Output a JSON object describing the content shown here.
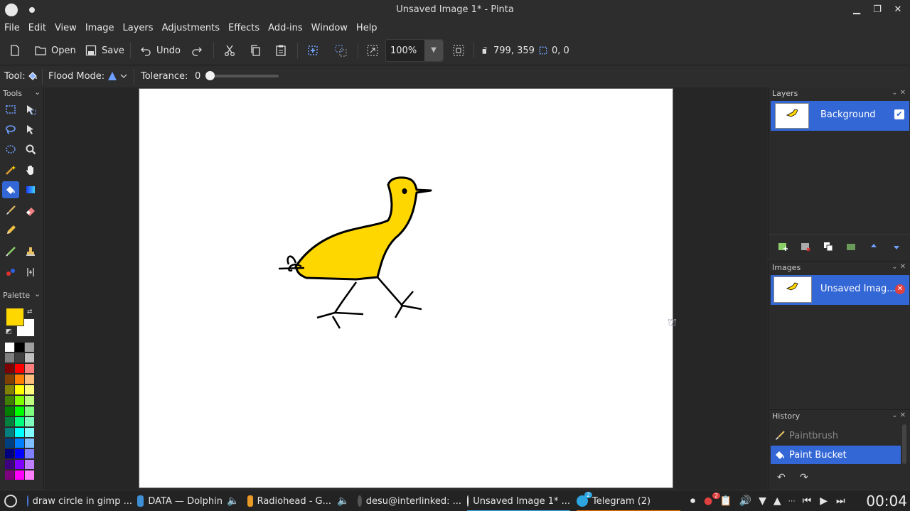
{
  "window": {
    "title": "Unsaved Image 1* - Pinta"
  },
  "menu": [
    "File",
    "Edit",
    "View",
    "Image",
    "Layers",
    "Adjustments",
    "Effects",
    "Add-ins",
    "Window",
    "Help"
  ],
  "toolbar": {
    "open_label": "Open",
    "save_label": "Save",
    "undo_label": "Undo",
    "zoom_value": "100%",
    "cursor_position": "799, 359",
    "selection_size": "0, 0"
  },
  "tool_options": {
    "tool_label": "Tool:",
    "flood_mode_label": "Flood Mode:",
    "tolerance_label": "Tolerance:",
    "tolerance_value": "0",
    "tolerance_fraction": 0
  },
  "tools_panel": {
    "title": "Tools",
    "active_tool": "paint-bucket"
  },
  "palette": {
    "title": "Palette",
    "primary_color": "#ffd700",
    "secondary_color": "#ffffff"
  },
  "layers_panel": {
    "title": "Layers",
    "layers": [
      {
        "name": "Background",
        "visible": true
      }
    ]
  },
  "images_panel": {
    "title": "Images",
    "images": [
      {
        "name": "Unsaved Imag..."
      }
    ]
  },
  "history_panel": {
    "title": "History",
    "items": [
      {
        "label": "Paintbrush",
        "active": false
      },
      {
        "label": "Paint Bucket",
        "active": true
      }
    ]
  },
  "taskbar": {
    "tasks": [
      {
        "label": "draw circle in gimp ...",
        "icon": "browser-icon"
      },
      {
        "label": "DATA — Dolphin",
        "icon": "folder-icon"
      },
      {
        "label": "Radiohead - G...",
        "icon": "media-icon"
      },
      {
        "label": "desu@interlinked: ...",
        "icon": "terminal-icon"
      },
      {
        "label": "Unsaved Image 1* ...",
        "icon": "pinta-icon"
      },
      {
        "label": "Telegram (2)",
        "icon": "telegram-icon"
      }
    ],
    "notification_badge": "2",
    "telegram_badge": "2",
    "clock": "00:04"
  }
}
